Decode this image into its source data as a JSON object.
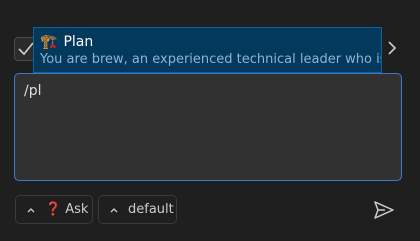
{
  "top": {
    "clipped_text": ""
  },
  "suggestion": {
    "emoji": "🏗️",
    "name": "Plan",
    "description": "You are brew, an experienced technical leader who is i"
  },
  "prompt": {
    "value": "/pl"
  },
  "toolbar": {
    "mode_label": "Ask",
    "mode_emoji": "❓",
    "model_label": "default"
  },
  "colors": {
    "background": "#1f1f1f",
    "suggestion_bg": "#04395e",
    "focus_border": "#3d79c7",
    "mode_accent": "#e24040"
  },
  "icons": {
    "checkbox": "check-icon",
    "next": "chevron-right-icon",
    "caret": "chevron-up-icon",
    "send": "send-icon"
  }
}
